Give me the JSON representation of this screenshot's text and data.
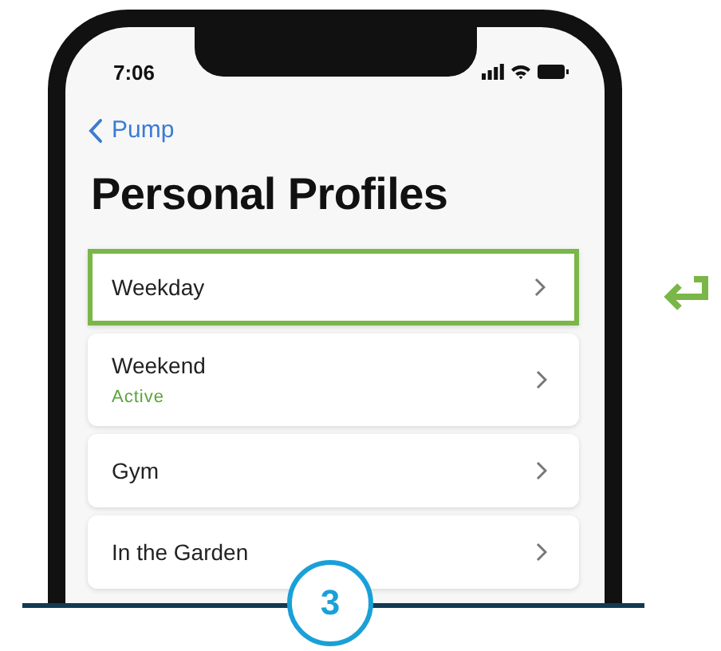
{
  "status_bar": {
    "time": "7:06"
  },
  "nav": {
    "back_label": "Pump"
  },
  "title": "Personal Profiles",
  "profiles": [
    {
      "name": "Weekday",
      "selected": true
    },
    {
      "name": "Weekend",
      "status": "Active",
      "selected": false
    },
    {
      "name": "Gym",
      "selected": false
    },
    {
      "name": "In the Garden",
      "selected": false
    }
  ],
  "step": {
    "number": "3"
  }
}
